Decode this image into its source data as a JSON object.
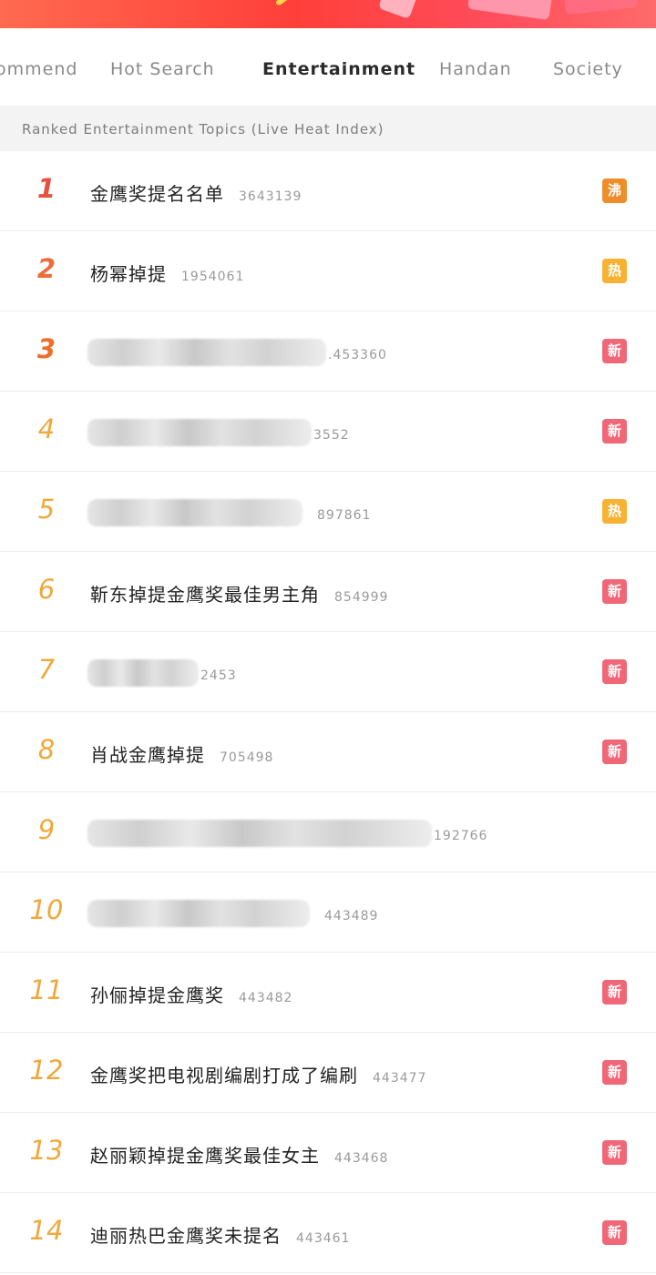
{
  "tabs": [
    {
      "label": "ommend"
    },
    {
      "label": "Hot Search"
    },
    {
      "label": "Entertainment"
    },
    {
      "label": "Handan"
    },
    {
      "label": "Society"
    }
  ],
  "section": {
    "title": "Ranked Entertainment Topics (Live Heat Index)"
  },
  "badges": {
    "boil": "沸",
    "hot": "热",
    "new": "新"
  },
  "colors": {
    "accent": "#f5a623",
    "badge_boil": "#f08d2b",
    "badge_hot": "#f7b232",
    "badge_new": "#f06778"
  },
  "list": [
    {
      "rank": "1",
      "title": "金鹰奖提名名单",
      "heat": "3643139",
      "badge": "沸"
    },
    {
      "rank": "2",
      "title": "杨幂掉提",
      "heat": "1954061",
      "badge": "热"
    },
    {
      "rank": "3",
      "title": "",
      "heat": ".453360",
      "badge": "新"
    },
    {
      "rank": "4",
      "title": "",
      "heat": "3552",
      "badge": "新"
    },
    {
      "rank": "5",
      "title": "",
      "heat": "897861",
      "badge": "热"
    },
    {
      "rank": "6",
      "title": "靳东掉提金鹰奖最佳男主角",
      "heat": "854999",
      "badge": "新"
    },
    {
      "rank": "7",
      "title": "",
      "heat": "2453",
      "badge": "新"
    },
    {
      "rank": "8",
      "title": "肖战金鹰掉提",
      "heat": "705498",
      "badge": "新"
    },
    {
      "rank": "9",
      "title": "",
      "heat": "192766",
      "badge": ""
    },
    {
      "rank": "10",
      "title": "",
      "heat": "443489",
      "badge": ""
    },
    {
      "rank": "11",
      "title": "孙俪掉提金鹰奖",
      "heat": "443482",
      "badge": "新"
    },
    {
      "rank": "12",
      "title": "金鹰奖把电视剧编剧打成了编刷",
      "heat": "443477",
      "badge": "新"
    },
    {
      "rank": "13",
      "title": "赵丽颖掉提金鹰奖最佳女主",
      "heat": "443468",
      "badge": "新"
    },
    {
      "rank": "14",
      "title": "迪丽热巴金鹰奖未提名",
      "heat": "443461",
      "badge": "新"
    }
  ]
}
